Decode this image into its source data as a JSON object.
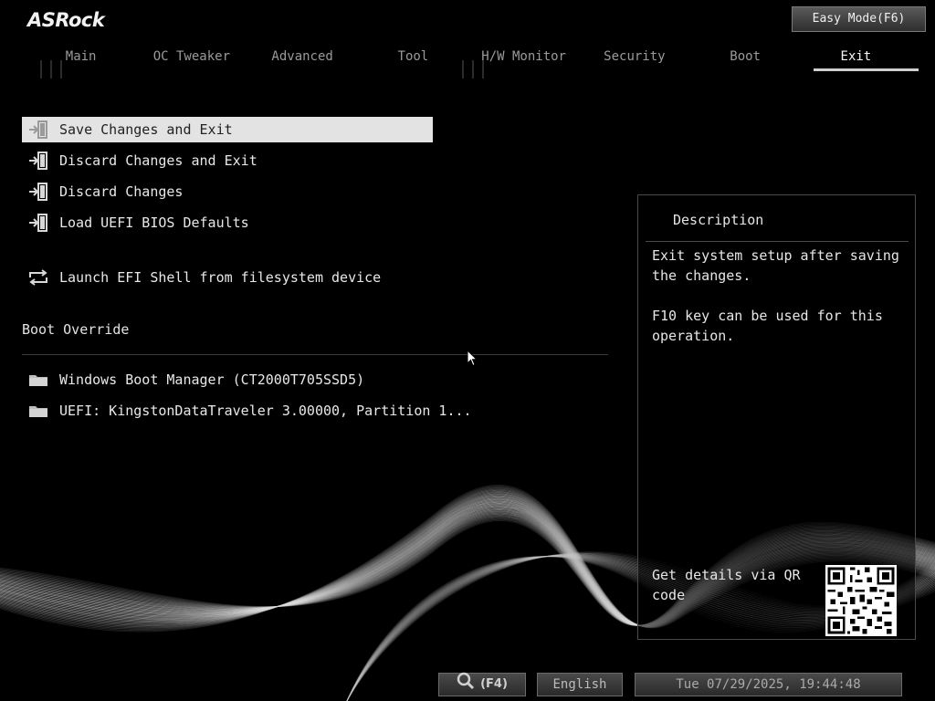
{
  "header": {
    "logo": "ASRock",
    "easy_mode_label": "Easy Mode(F6)"
  },
  "tabs": [
    {
      "label": "Main",
      "active": false
    },
    {
      "label": "OC Tweaker",
      "active": false
    },
    {
      "label": "Advanced",
      "active": false
    },
    {
      "label": "Tool",
      "active": false
    },
    {
      "label": "H/W Monitor",
      "active": false
    },
    {
      "label": "Security",
      "active": false
    },
    {
      "label": "Boot",
      "active": false
    },
    {
      "label": "Exit",
      "active": true
    }
  ],
  "menu": {
    "items": [
      {
        "label": "Save Changes and Exit",
        "icon": "exit-door-icon",
        "selected": true
      },
      {
        "label": "Discard Changes and Exit",
        "icon": "exit-door-icon",
        "selected": false
      },
      {
        "label": "Discard Changes",
        "icon": "exit-door-icon",
        "selected": false
      },
      {
        "label": "Load UEFI BIOS Defaults",
        "icon": "exit-door-icon",
        "selected": false
      },
      {
        "label": "Launch EFI Shell from filesystem device",
        "icon": "refresh-arrows-icon",
        "selected": false
      }
    ],
    "boot_override_title": "Boot Override",
    "boot_items": [
      {
        "label": "Windows Boot Manager (CT2000T705SSD5)",
        "icon": "folder-icon"
      },
      {
        "label": "UEFI: KingstonDataTraveler 3.00000, Partition 1...",
        "icon": "folder-icon"
      }
    ]
  },
  "description": {
    "title": "Description",
    "paragraphs": [
      "Exit system setup after saving the changes.",
      "F10 key can be used for this operation."
    ],
    "qr_label": "Get details via QR code"
  },
  "footer": {
    "search_key": "(F4)",
    "language": "English",
    "datetime": "Tue 07/29/2025, 19:44:48"
  },
  "colors": {
    "background": "#000000",
    "selected_bg": "#e3e3e3",
    "text": "#e6e6e6",
    "tab_inactive": "#9a9a9a"
  }
}
